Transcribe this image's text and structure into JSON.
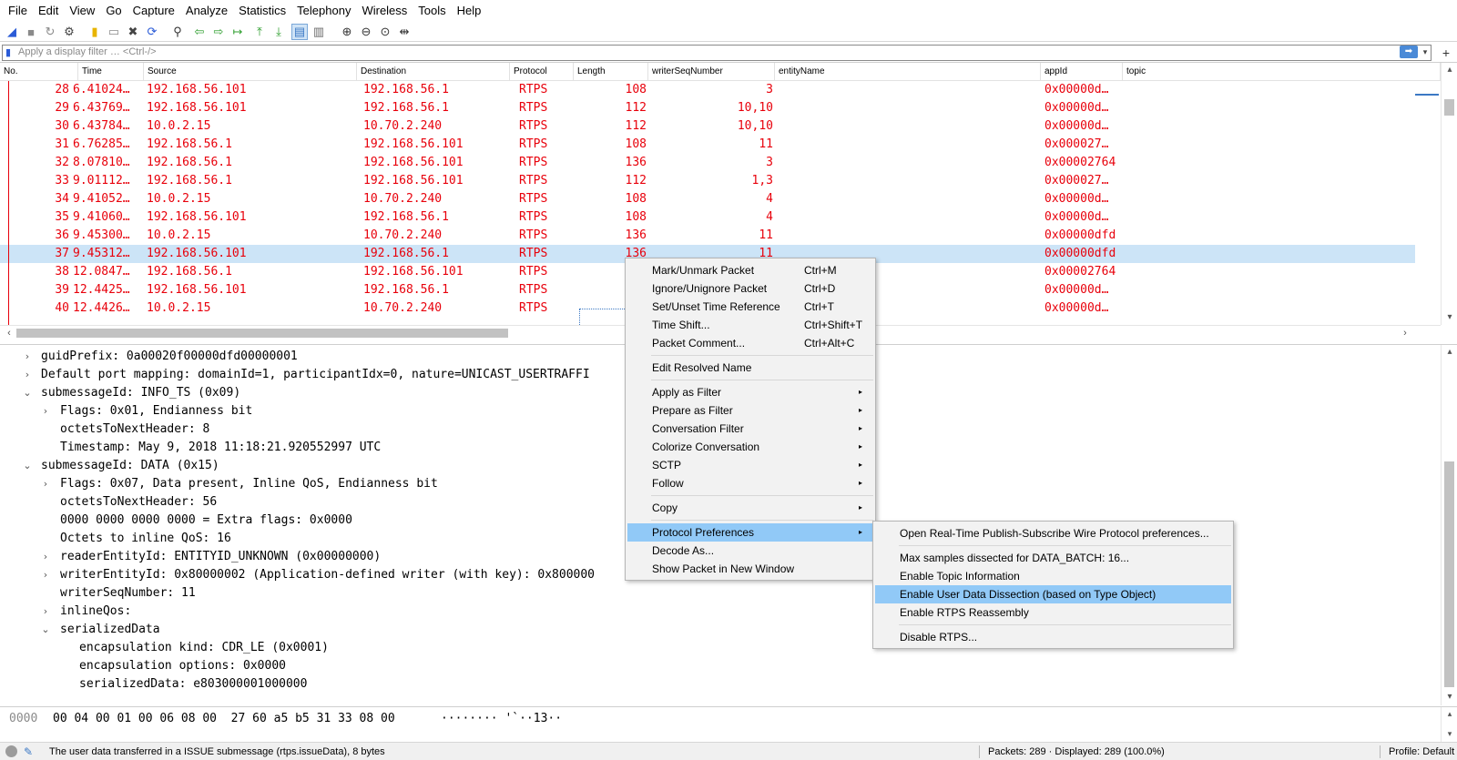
{
  "menubar": [
    "File",
    "Edit",
    "View",
    "Go",
    "Capture",
    "Analyze",
    "Statistics",
    "Telephony",
    "Wireless",
    "Tools",
    "Help"
  ],
  "toolbar": {
    "icons": [
      "shark-fin-start-icon",
      "stop-capture-icon",
      "restart-capture-icon",
      "capture-options-icon",
      "open-file-icon",
      "save-file-icon",
      "close-file-icon",
      "reload-file-icon",
      "find-packet-icon",
      "go-back-icon",
      "go-forward-icon",
      "go-to-packet-icon",
      "go-first-icon",
      "go-last-icon",
      "auto-scroll-icon",
      "colorize-icon",
      "zoom-in-icon",
      "zoom-out-icon",
      "zoom-normal-icon",
      "resize-columns-icon"
    ]
  },
  "filter": {
    "placeholder": "Apply a display filter … <Ctrl-/>",
    "apply_glyph": "➡",
    "dropdown_glyph": "▾",
    "add_glyph": "+"
  },
  "packet_list": {
    "columns": [
      "No.",
      "Time",
      "Source",
      "Destination",
      "Protocol",
      "Length",
      "writerSeqNumber",
      "entityName",
      "appId",
      "topic"
    ],
    "selected_index": 9,
    "rows": [
      {
        "no": "28",
        "time": "6.41024…",
        "source": "192.168.56.101",
        "destination": "192.168.56.1",
        "protocol": "RTPS",
        "length": "108",
        "seq": "3",
        "appid": "0x00000d…"
      },
      {
        "no": "29",
        "time": "6.43769…",
        "source": "192.168.56.101",
        "destination": "192.168.56.1",
        "protocol": "RTPS",
        "length": "112",
        "seq": "10,10",
        "appid": "0x00000d…"
      },
      {
        "no": "30",
        "time": "6.43784…",
        "source": "10.0.2.15",
        "destination": "10.70.2.240",
        "protocol": "RTPS",
        "length": "112",
        "seq": "10,10",
        "appid": "0x00000d…"
      },
      {
        "no": "31",
        "time": "6.76285…",
        "source": "192.168.56.1",
        "destination": "192.168.56.101",
        "protocol": "RTPS",
        "length": "108",
        "seq": "11",
        "appid": "0x000027…"
      },
      {
        "no": "32",
        "time": "8.07810…",
        "source": "192.168.56.1",
        "destination": "192.168.56.101",
        "protocol": "RTPS",
        "length": "136",
        "seq": "3",
        "appid": "0x00002764"
      },
      {
        "no": "33",
        "time": "9.01112…",
        "source": "192.168.56.1",
        "destination": "192.168.56.101",
        "protocol": "RTPS",
        "length": "112",
        "seq": "1,3",
        "appid": "0x000027…"
      },
      {
        "no": "34",
        "time": "9.41052…",
        "source": "10.0.2.15",
        "destination": "10.70.2.240",
        "protocol": "RTPS",
        "length": "108",
        "seq": "4",
        "appid": "0x00000d…"
      },
      {
        "no": "35",
        "time": "9.41060…",
        "source": "192.168.56.101",
        "destination": "192.168.56.1",
        "protocol": "RTPS",
        "length": "108",
        "seq": "4",
        "appid": "0x00000d…"
      },
      {
        "no": "36",
        "time": "9.45300…",
        "source": "10.0.2.15",
        "destination": "10.70.2.240",
        "protocol": "RTPS",
        "length": "136",
        "seq": "11",
        "appid": "0x00000dfd"
      },
      {
        "no": "37",
        "time": "9.45312…",
        "source": "192.168.56.101",
        "destination": "192.168.56.1",
        "protocol": "RTPS",
        "length": "136",
        "seq": "11",
        "appid": "0x00000dfd"
      },
      {
        "no": "38",
        "time": "12.0847…",
        "source": "192.168.56.1",
        "destination": "192.168.56.101",
        "protocol": "RTPS",
        "length": "",
        "seq": "",
        "appid": "0x00002764"
      },
      {
        "no": "39",
        "time": "12.4425…",
        "source": "192.168.56.101",
        "destination": "192.168.56.1",
        "protocol": "RTPS",
        "length": "",
        "seq": "",
        "appid": "0x00000d…"
      },
      {
        "no": "40",
        "time": "12.4426…",
        "source": "10.0.2.15",
        "destination": "10.70.2.240",
        "protocol": "RTPS",
        "length": "",
        "seq": "",
        "appid": "0x00000d…"
      }
    ],
    "scroll": {
      "up": "▴",
      "down": "▾",
      "left": "‹",
      "right": "›"
    }
  },
  "details": {
    "lines": [
      {
        "indent": 1,
        "chevron": "›",
        "text": "guidPrefix: 0a00020f00000dfd00000001"
      },
      {
        "indent": 1,
        "chevron": "›",
        "text": "Default port mapping: domainId=1, participantIdx=0, nature=UNICAST_USERTRAFFI"
      },
      {
        "indent": 1,
        "chevron": "⌄",
        "text": "submessageId: INFO_TS (0x09)"
      },
      {
        "indent": 2,
        "chevron": "›",
        "text": "Flags: 0x01, Endianness bit"
      },
      {
        "indent": 2,
        "chevron": "",
        "text": "octetsToNextHeader: 8"
      },
      {
        "indent": 2,
        "chevron": "",
        "text": "Timestamp: May  9, 2018 11:18:21.920552997 UTC"
      },
      {
        "indent": 1,
        "chevron": "⌄",
        "text": "submessageId: DATA (0x15)"
      },
      {
        "indent": 2,
        "chevron": "›",
        "text": "Flags: 0x07, Data present, Inline QoS, Endianness bit"
      },
      {
        "indent": 2,
        "chevron": "",
        "text": "octetsToNextHeader: 56"
      },
      {
        "indent": 2,
        "chevron": "",
        "text": "0000 0000 0000 0000 = Extra flags: 0x0000"
      },
      {
        "indent": 2,
        "chevron": "",
        "text": "Octets to inline QoS: 16"
      },
      {
        "indent": 2,
        "chevron": "›",
        "text": "readerEntityId: ENTITYID_UNKNOWN (0x00000000)"
      },
      {
        "indent": 2,
        "chevron": "›",
        "text": "writerEntityId: 0x80000002 (Application-defined writer (with key): 0x800000"
      },
      {
        "indent": 2,
        "chevron": "",
        "text": "writerSeqNumber: 11"
      },
      {
        "indent": 2,
        "chevron": "›",
        "text": "inlineQos:"
      },
      {
        "indent": 2,
        "chevron": "⌄",
        "text": "serializedData"
      },
      {
        "indent": 3,
        "chevron": "",
        "text": "encapsulation kind: CDR_LE (0x0001)"
      },
      {
        "indent": 3,
        "chevron": "",
        "text": "encapsulation options: 0x0000"
      },
      {
        "indent": 3,
        "chevron": "",
        "text": "serializedData: e803000001000000"
      }
    ]
  },
  "bytes": {
    "offset": "0000",
    "hex": "00 04 00 01 00 06 08 00  27 60 a5 b5 31 33 08 00",
    "ascii": "········ '`··13··"
  },
  "status": {
    "message": "The user data transferred in a ISSUE submessage (rtps.issueData), 8 bytes",
    "packets": "Packets: 289 · Displayed: 289 (100.0%)",
    "profile": "Profile: Default"
  },
  "context_menu": {
    "items": [
      {
        "type": "item",
        "label": "Mark/Unmark Packet",
        "shortcut": "Ctrl+M"
      },
      {
        "type": "item",
        "label": "Ignore/Unignore Packet",
        "shortcut": "Ctrl+D"
      },
      {
        "type": "item",
        "label": "Set/Unset Time Reference",
        "shortcut": "Ctrl+T"
      },
      {
        "type": "item",
        "label": "Time Shift...",
        "shortcut": "Ctrl+Shift+T"
      },
      {
        "type": "item",
        "label": "Packet Comment...",
        "shortcut": "Ctrl+Alt+C"
      },
      {
        "type": "sep"
      },
      {
        "type": "item",
        "label": "Edit Resolved Name",
        "shortcut": ""
      },
      {
        "type": "sep"
      },
      {
        "type": "item",
        "label": "Apply as Filter",
        "shortcut": "",
        "submenu": true
      },
      {
        "type": "item",
        "label": "Prepare as Filter",
        "shortcut": "",
        "submenu": true
      },
      {
        "type": "item",
        "label": "Conversation Filter",
        "shortcut": "",
        "submenu": true
      },
      {
        "type": "item",
        "label": "Colorize Conversation",
        "shortcut": "",
        "submenu": true
      },
      {
        "type": "item",
        "label": "SCTP",
        "shortcut": "",
        "submenu": true
      },
      {
        "type": "item",
        "label": "Follow",
        "shortcut": "",
        "submenu": true
      },
      {
        "type": "sep"
      },
      {
        "type": "item",
        "label": "Copy",
        "shortcut": "",
        "submenu": true
      },
      {
        "type": "sep"
      },
      {
        "type": "item",
        "label": "Protocol Preferences",
        "shortcut": "",
        "submenu": true,
        "highlight": true
      },
      {
        "type": "item",
        "label": "Decode As...",
        "shortcut": ""
      },
      {
        "type": "item",
        "label": "Show Packet in New Window",
        "shortcut": ""
      }
    ],
    "arrow_glyph": "▸"
  },
  "submenu": {
    "items": [
      {
        "type": "item",
        "label": "Open Real-Time Publish-Subscribe Wire Protocol preferences..."
      },
      {
        "type": "sep"
      },
      {
        "type": "item",
        "label": "Max samples dissected for DATA_BATCH: 16..."
      },
      {
        "type": "item",
        "label": "Enable Topic Information"
      },
      {
        "type": "item",
        "label": "Enable User Data Dissection (based on Type Object)",
        "highlight": true
      },
      {
        "type": "item",
        "label": "Enable RTPS Reassembly"
      },
      {
        "type": "sep"
      },
      {
        "type": "item",
        "label": "Disable RTPS..."
      }
    ]
  },
  "colors": {
    "packet_text": "#e8000b",
    "selected_row": "#cce4f7",
    "menu_highlight": "#91c9f7"
  }
}
